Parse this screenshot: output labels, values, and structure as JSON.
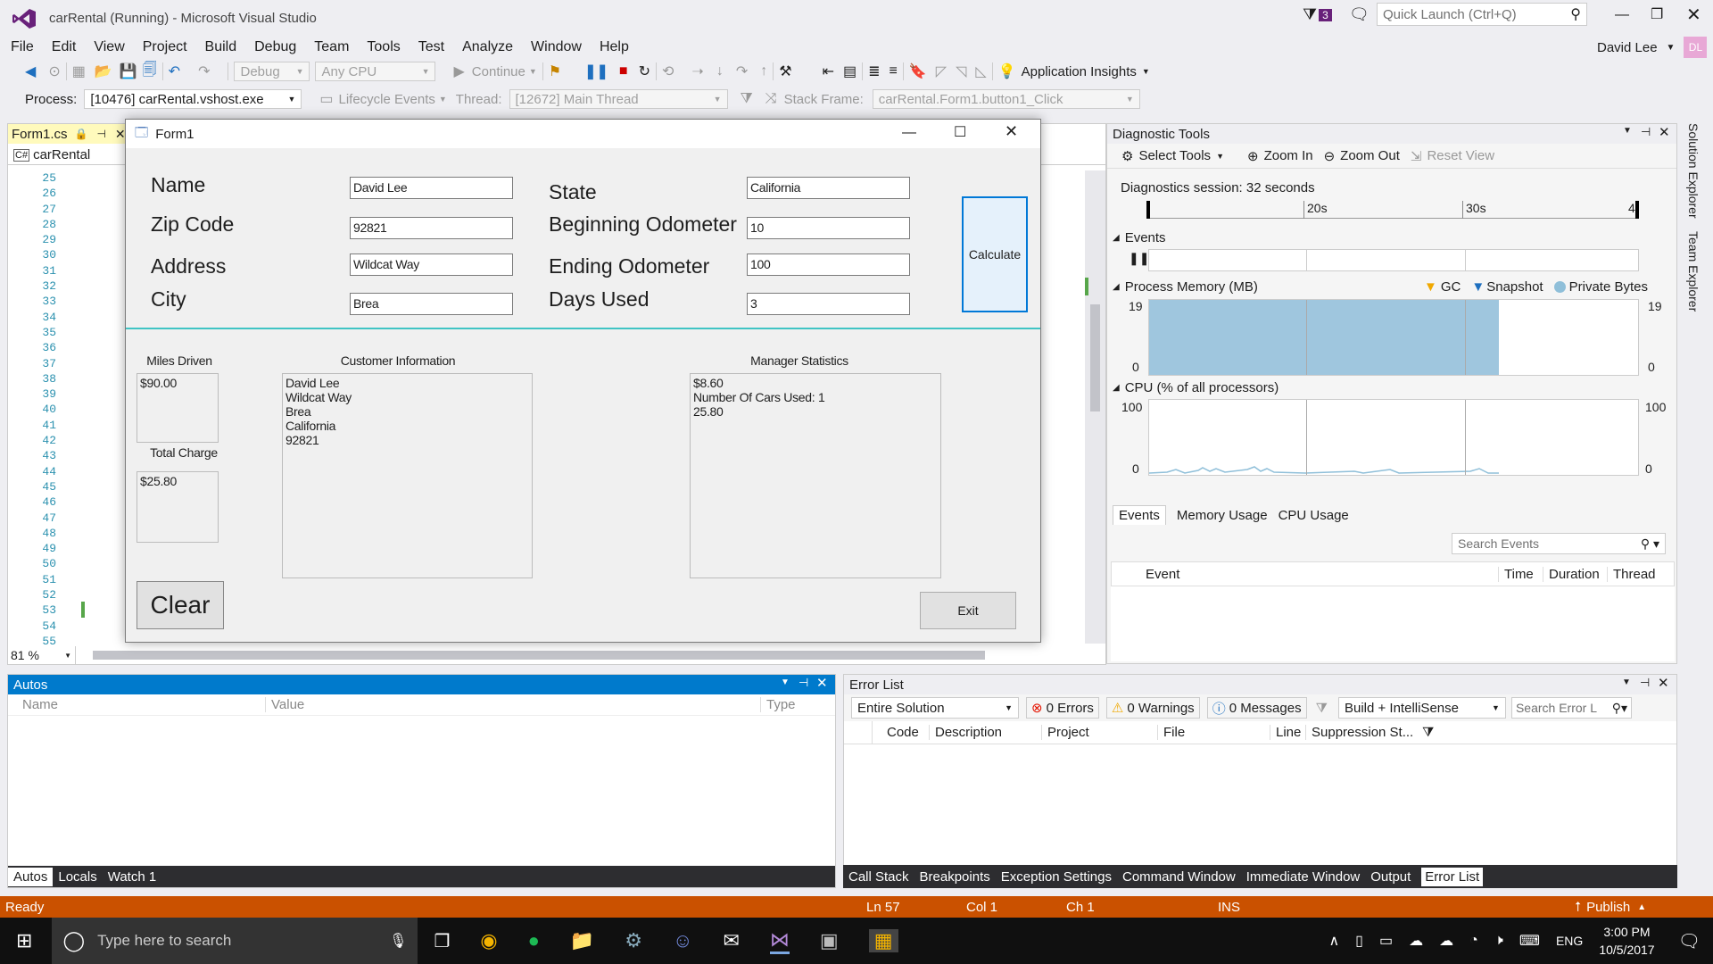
{
  "window": {
    "title": "carRental (Running) - Microsoft Visual Studio",
    "quick_launch_placeholder": "Quick Launch (Ctrl+Q)",
    "notif_count": "3",
    "user": "David Lee",
    "user_initials": "DL"
  },
  "menu": [
    "File",
    "Edit",
    "View",
    "Project",
    "Build",
    "Debug",
    "Team",
    "Tools",
    "Test",
    "Analyze",
    "Window",
    "Help"
  ],
  "toolbar": {
    "config": "Debug",
    "platform": "Any CPU",
    "continue": "Continue",
    "app_insights": "Application Insights"
  },
  "debugbar": {
    "process_label": "Process:",
    "process_value": "[10476] carRental.vshost.exe",
    "lifecycle": "Lifecycle Events",
    "thread_label": "Thread:",
    "thread_value": "[12672] Main Thread",
    "stack_label": "Stack Frame:",
    "stack_value": "carRental.Form1.button1_Click"
  },
  "editor": {
    "tab": "Form1.cs",
    "nav": "carRental",
    "zoom": "81 %",
    "lines": [
      "25",
      "26",
      "27",
      "28",
      "29",
      "30",
      "31",
      "32",
      "33",
      "34",
      "35",
      "36",
      "37",
      "38",
      "39",
      "40",
      "41",
      "42",
      "43",
      "44",
      "45",
      "46",
      "47",
      "48",
      "49",
      "50",
      "51",
      "52",
      "53",
      "54",
      "55"
    ]
  },
  "form": {
    "title": "Form1",
    "labels": {
      "name": "Name",
      "zip": "Zip Code",
      "address": "Address",
      "city": "City",
      "state": "State",
      "begin": "Beginning Odometer",
      "end": "Ending Odometer",
      "days": "Days Used"
    },
    "values": {
      "name": "David Lee",
      "zip": "92821",
      "address": "Wildcat Way",
      "city": "Brea",
      "state": "California",
      "begin": "10",
      "end": "100",
      "days": "3"
    },
    "calculate": "Calculate",
    "miles_label": "Miles Driven",
    "miles_value": "$90.00",
    "total_label": "Total Charge",
    "total_value": "$25.80",
    "cust_label": "Customer Information",
    "cust_lines": [
      "David Lee",
      "Wildcat Way",
      "Brea",
      "California",
      "92821"
    ],
    "mgr_label": "Manager Statistics",
    "mgr_lines": [
      "$8.60",
      "Number Of Cars Used: 1",
      "25.80"
    ],
    "clear": "Clear",
    "exit": "Exit"
  },
  "diag": {
    "title": "Diagnostic Tools",
    "select_tools": "Select Tools",
    "zoom_in": "Zoom In",
    "zoom_out": "Zoom Out",
    "reset_view": "Reset View",
    "session": "Diagnostics session: 32 seconds",
    "t20": "20s",
    "t30": "30s",
    "t4": "4",
    "events": "Events",
    "memory": "Process Memory (MB)",
    "gc": "GC",
    "snapshot": "Snapshot",
    "private_bytes": "Private Bytes",
    "mem_max": "19",
    "mem_min": "0",
    "mem_fill_fraction": 1.0,
    "cpu": "CPU (% of all processors)",
    "cpu_max": "100",
    "cpu_min": "0",
    "tabs": [
      "Events",
      "Memory Usage",
      "CPU Usage"
    ],
    "search": "Search Events",
    "cols": [
      "Event",
      "Time",
      "Duration",
      "Thread"
    ],
    "side": [
      "Solution Explorer",
      "Team Explorer"
    ]
  },
  "autos": {
    "title": "Autos",
    "cols": [
      "Name",
      "Value",
      "Type"
    ],
    "tabs": [
      "Autos",
      "Locals",
      "Watch 1"
    ]
  },
  "errors": {
    "title": "Error List",
    "scope": "Entire Solution",
    "errors": "0 Errors",
    "warnings": "0 Warnings",
    "messages": "0 Messages",
    "build": "Build + IntelliSense",
    "search": "Search Error L",
    "cols": [
      "Code",
      "Description",
      "Project",
      "File",
      "Line",
      "Suppression St..."
    ]
  },
  "bottom_tabs": [
    "Call Stack",
    "Breakpoints",
    "Exception Settings",
    "Command Window",
    "Immediate Window",
    "Output",
    "Error List"
  ],
  "status": {
    "ready": "Ready",
    "ln": "Ln 57",
    "col": "Col 1",
    "ch": "Ch 1",
    "ins": "INS",
    "publish": "Publish"
  },
  "taskbar": {
    "search": "Type here to search",
    "time": "3:00 PM",
    "date": "10/5/2017",
    "lang": "ENG"
  }
}
